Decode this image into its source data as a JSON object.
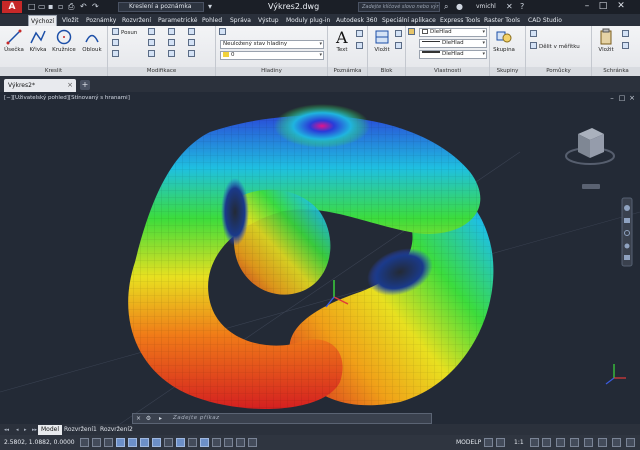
{
  "titlebar": {
    "logo": "A",
    "workspace": "Kreslení a poznámka",
    "document_title": "Výkres2.dwg",
    "search_placeholder": "Zadejte klíčové slovo nebo výraz",
    "user": "vmichl"
  },
  "ribbon_tabs": [
    "Výchozí",
    "Vložit",
    "Poznámky",
    "Rozvržení",
    "Parametrické",
    "Pohled",
    "Správa",
    "Výstup",
    "Moduly plug-in",
    "Autodesk 360",
    "Speciální aplikace",
    "Express Tools",
    "Raster Tools",
    "CAD Studio"
  ],
  "active_tab": "Výchozí",
  "panels": {
    "kreslit": {
      "title": "Kreslit",
      "tools": [
        "Úsečka",
        "Křivka",
        "Kružnice",
        "Oblouk"
      ]
    },
    "modifikace": {
      "title": "Modifikace",
      "tools": [
        "Posun"
      ]
    },
    "hladiny": {
      "title": "Hladiny",
      "layer_state": "Neuložený stav hladiny",
      "current_layer": "0"
    },
    "poznamka": {
      "title": "Poznámka",
      "tools": [
        "Text"
      ]
    },
    "blok": {
      "title": "Blok",
      "tools": [
        "Vložit"
      ]
    },
    "vlastnosti": {
      "title": "Vlastnosti",
      "color": "DleHlad",
      "linetype": "DleHlad",
      "lineweight": "DleHlad"
    },
    "skupiny": {
      "title": "Skupiny",
      "tools": [
        "Skupina"
      ]
    },
    "pomucky": {
      "title": "Pomůcky",
      "tools": [
        "Dělit v měřítku"
      ]
    },
    "schranka": {
      "title": "Schránka",
      "tools": [
        "Vložit"
      ]
    }
  },
  "file_tab": "Výkres2*",
  "viewport": {
    "label": "[−][Uživatelský pohled][Stínovaný s hranami]"
  },
  "command_prompt": "Zadejte příkaz",
  "layout_tabs": [
    "Model",
    "Rozvržení1",
    "Rozvržení2"
  ],
  "active_layout": "Model",
  "status": {
    "coordinates": "2.5802, 1.0882, 0.0000",
    "mode": "MODELP",
    "scale": "1:1"
  },
  "colors": {
    "title_bg": "#1b1f27",
    "viewport_bg": "#232a36",
    "accent": "#c62828"
  }
}
